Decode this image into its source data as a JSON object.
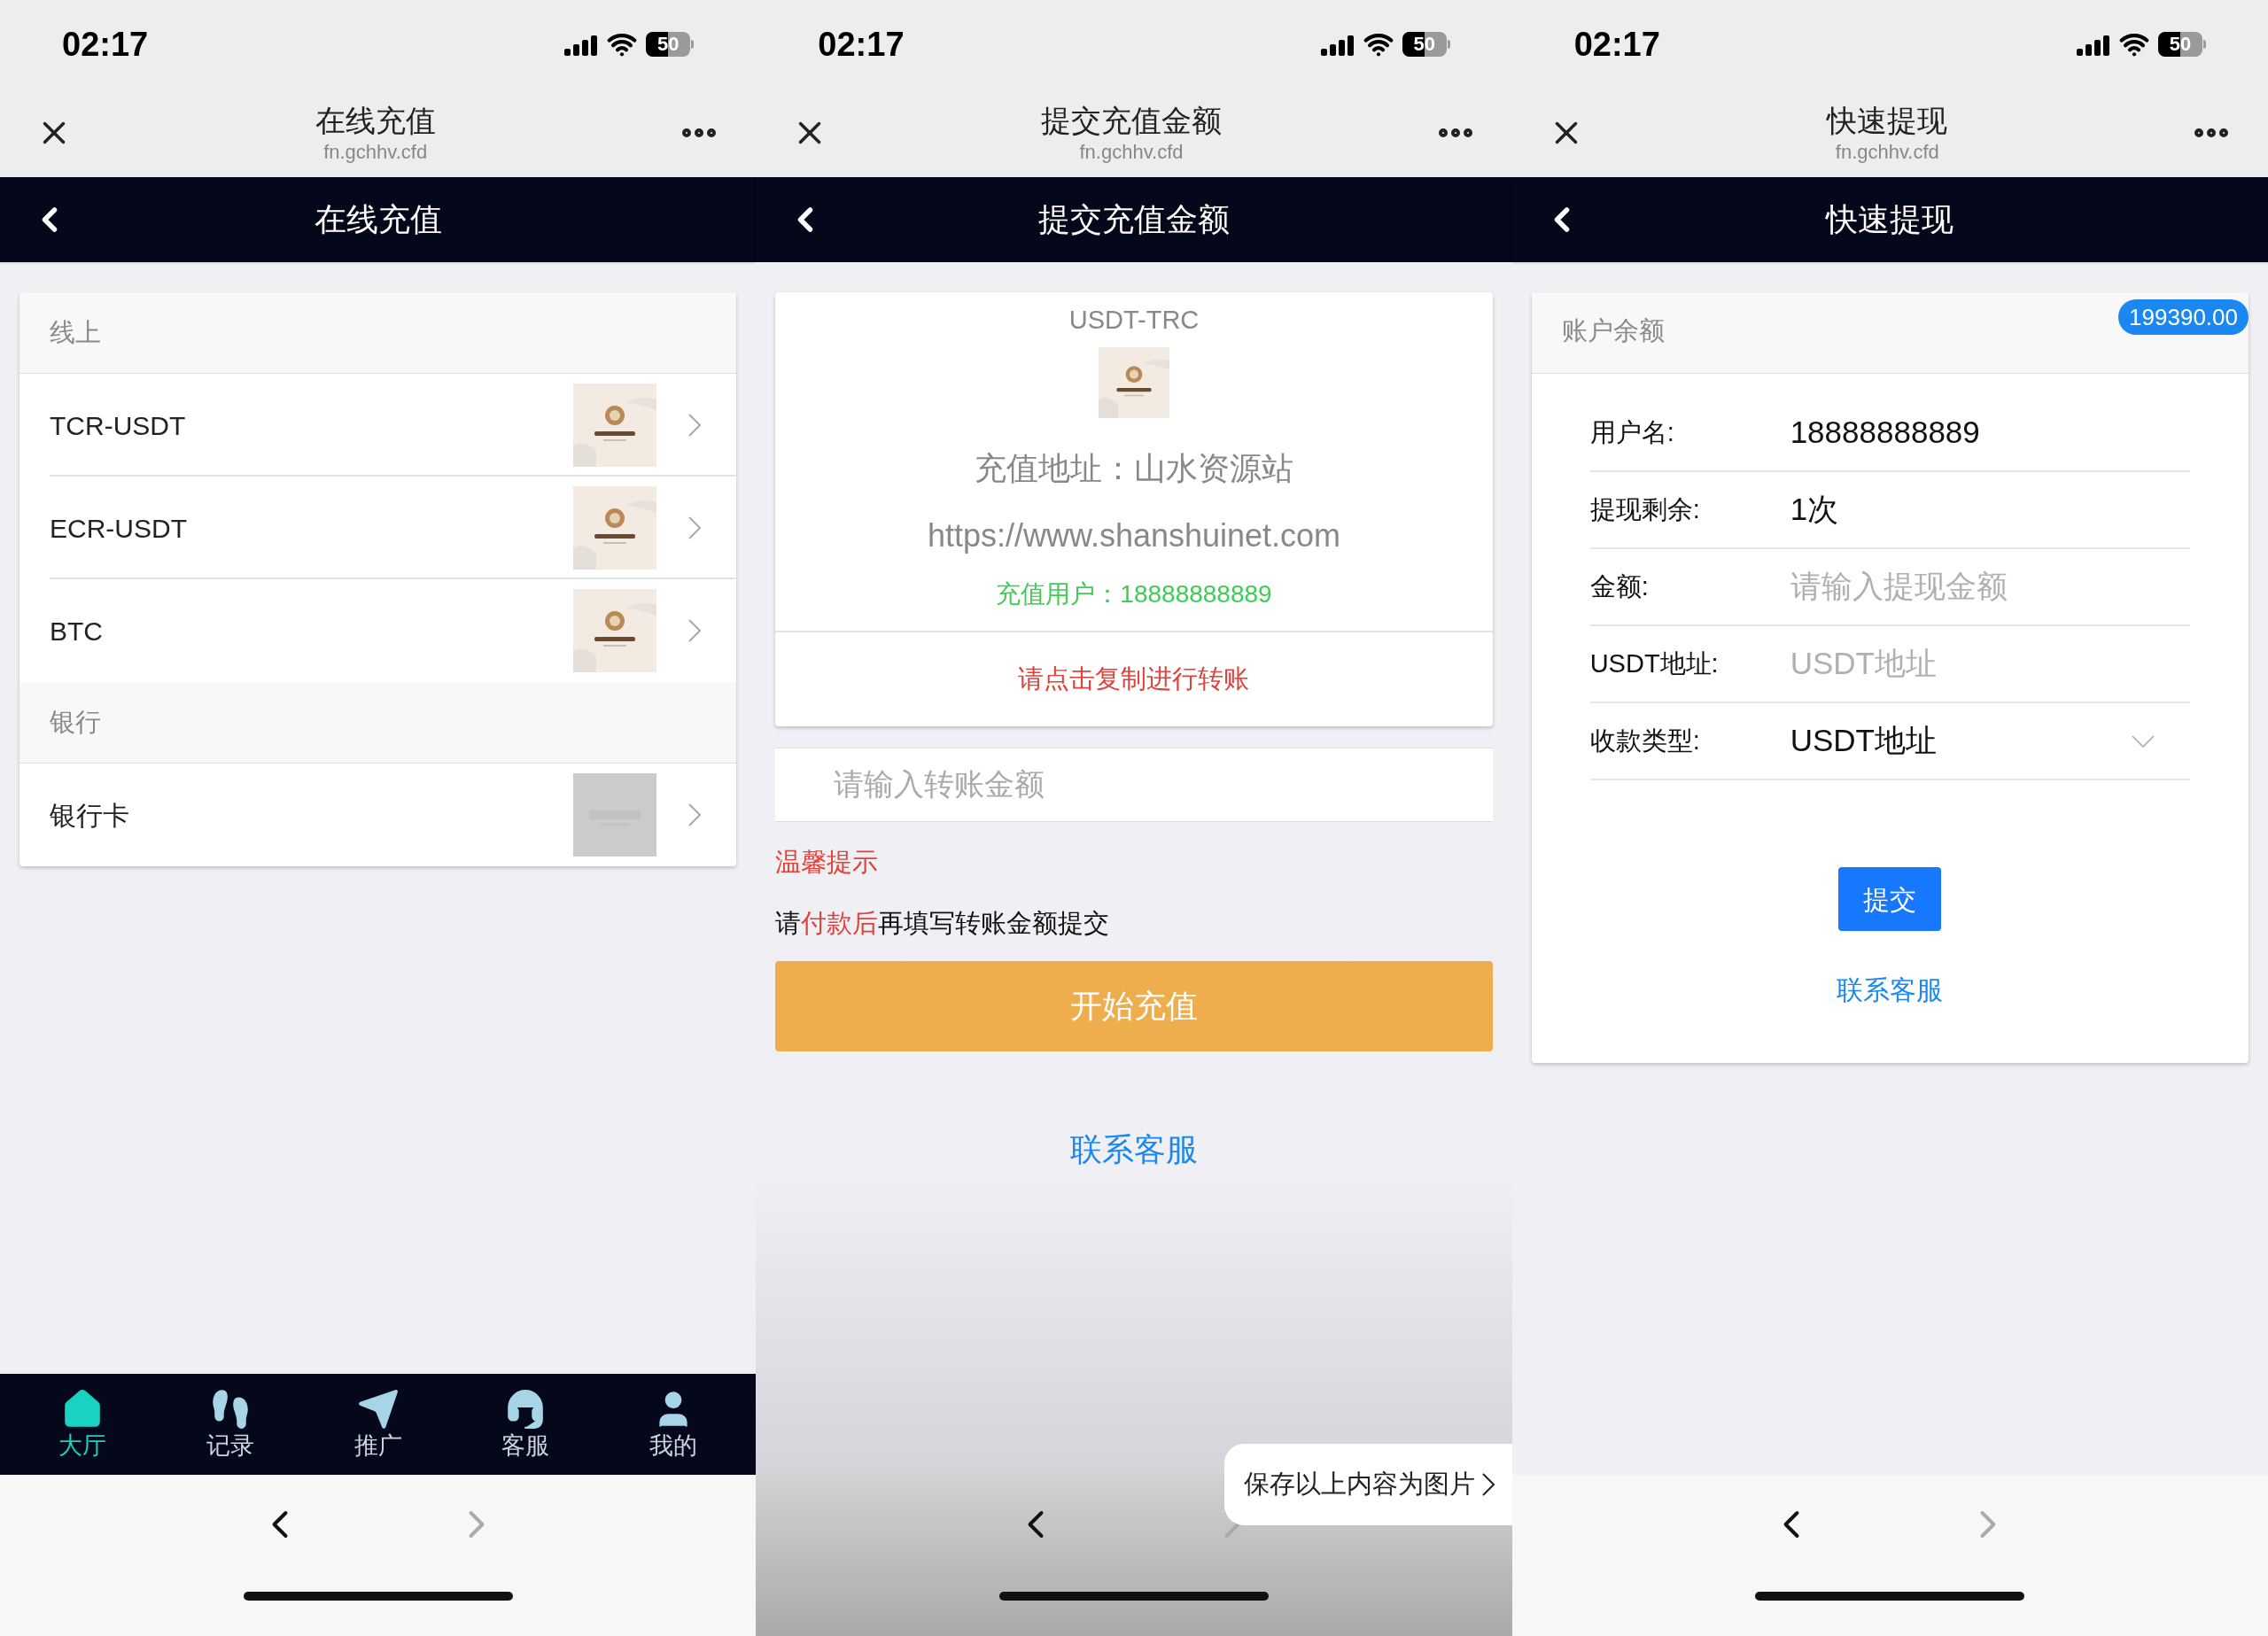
{
  "panels": [
    {
      "kind": "recharge_list",
      "status_bar": {
        "time": "02:17",
        "battery": "50"
      },
      "browser": {
        "title": "在线充值",
        "domain": "fn.gchhv.cfd"
      },
      "header": {
        "title": "在线充值"
      },
      "sections": [
        {
          "title": "线上",
          "items": [
            {
              "label": "TCR-USDT",
              "kind": "logo"
            },
            {
              "label": "ECR-USDT",
              "kind": "logo"
            },
            {
              "label": "BTC",
              "kind": "logo"
            }
          ]
        },
        {
          "title": "银行",
          "items": [
            {
              "label": "银行卡",
              "kind": "placeholder"
            }
          ]
        }
      ],
      "tab_bar": [
        {
          "label": "大厅",
          "selected": true
        },
        {
          "label": "记录",
          "selected": false
        },
        {
          "label": "推广",
          "selected": false
        },
        {
          "label": "客服",
          "selected": false
        },
        {
          "label": "我的",
          "selected": false
        }
      ]
    },
    {
      "kind": "submit_amount",
      "status_bar": {
        "time": "02:17",
        "battery": "50"
      },
      "browser": {
        "title": "提交充值金额",
        "domain": "fn.gchhv.cfd"
      },
      "header": {
        "title": "提交充值金额"
      },
      "card": {
        "title": "USDT-TRC",
        "address": "充值地址：山水资源站",
        "url": "https://www.shanshuinet.com",
        "user": "充值用户：18888888889",
        "copy_prompt": "请点击复制进行转账"
      },
      "amount_field": {
        "placeholder": "请输入转账金额"
      },
      "tip_title": "温馨提示",
      "tip_text": [
        {
          "text": "请",
          "highlight": false
        },
        {
          "text": "付款后",
          "highlight": true
        },
        {
          "text": "再填写转账金额提交",
          "highlight": false
        }
      ],
      "start_button": "开始充值",
      "contact_link": "联系客服",
      "save_popup": "保存以上内容为图片"
    },
    {
      "kind": "withdraw",
      "status_bar": {
        "time": "02:17",
        "battery": "50"
      },
      "browser": {
        "title": "快速提现",
        "domain": "fn.gchhv.cfd"
      },
      "header": {
        "title": "快速提现"
      },
      "balance_label": "账户余额",
      "balance": "199390.00",
      "fields": [
        {
          "label": "用户名:",
          "kind": "text",
          "value": "18888888889"
        },
        {
          "label": "提现剩余:",
          "kind": "text",
          "value": "1次"
        },
        {
          "label": "金额:",
          "kind": "input",
          "placeholder": "请输入提现金额"
        },
        {
          "label": "USDT地址:",
          "kind": "input",
          "placeholder": "USDT地址"
        },
        {
          "label": "收款类型:",
          "kind": "select",
          "value": "USDT地址"
        }
      ],
      "submit_button": "提交",
      "contact_link": "联系客服"
    }
  ]
}
